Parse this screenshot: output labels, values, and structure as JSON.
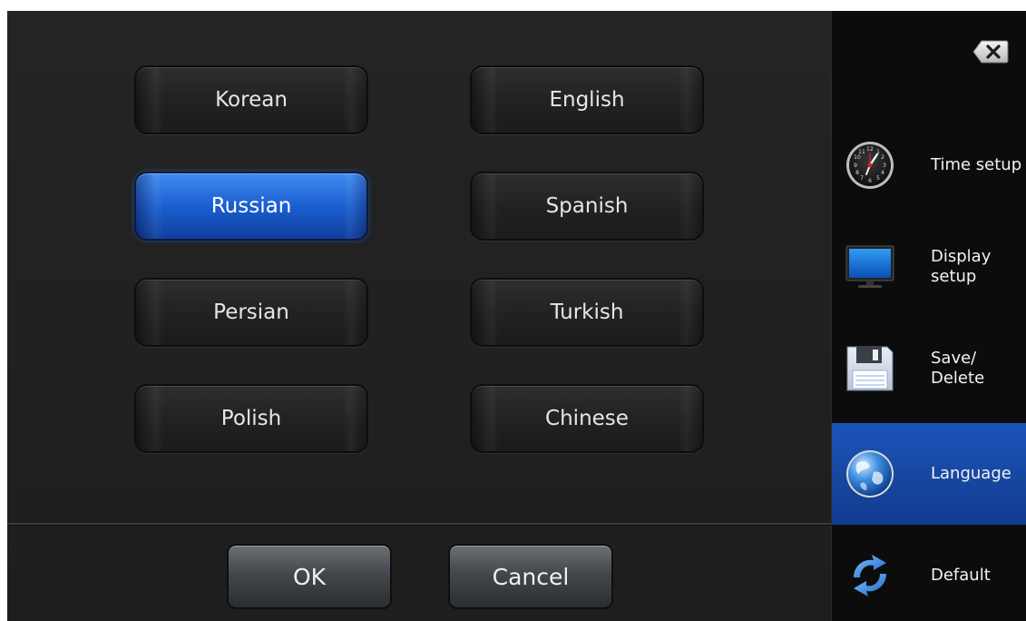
{
  "languages": {
    "korean": "Korean",
    "english": "English",
    "russian": "Russian",
    "spanish": "Spanish",
    "persian": "Persian",
    "turkish": "Turkish",
    "polish": "Polish",
    "chinese": "Chinese",
    "selected": "Russian"
  },
  "actions": {
    "ok": "OK",
    "cancel": "Cancel"
  },
  "sidebar": {
    "back_icon": "backspace-close-icon",
    "items": [
      {
        "label": "Time setup",
        "icon": "clock-icon"
      },
      {
        "label": "Display\nsetup",
        "icon": "monitor-icon"
      },
      {
        "label": "Save/\nDelete",
        "icon": "floppy-disk-icon"
      },
      {
        "label": "Language",
        "icon": "globe-icon",
        "active": true
      },
      {
        "label": "Default",
        "icon": "refresh-icon"
      }
    ]
  },
  "colors": {
    "accent": "#1c5fd0",
    "background": "#1c1c1c",
    "sidebar": "#0c0c0c"
  }
}
